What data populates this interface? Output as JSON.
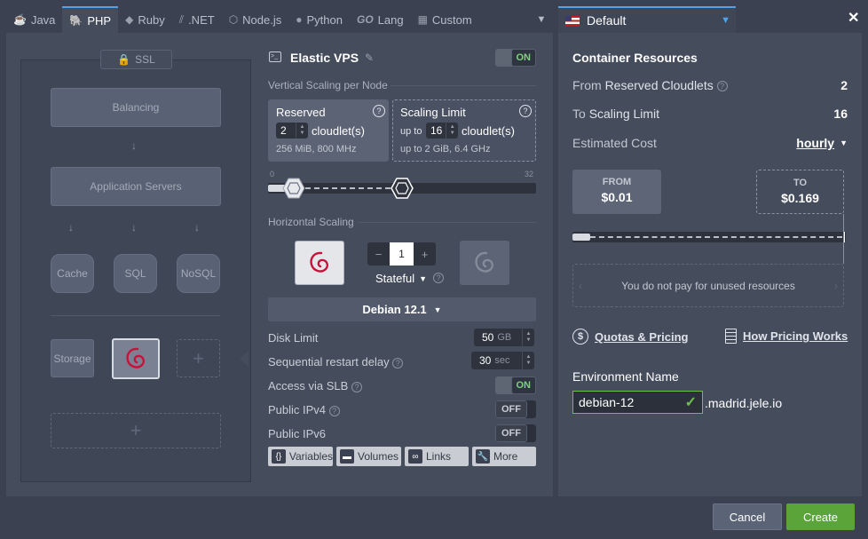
{
  "tabs": [
    {
      "label": "Java",
      "icon": "java-icon"
    },
    {
      "label": "PHP",
      "icon": "php-icon",
      "active": true
    },
    {
      "label": "Ruby",
      "icon": "ruby-icon"
    },
    {
      "label": ".NET",
      "icon": "dotnet-icon"
    },
    {
      "label": "Node.js",
      "icon": "nodejs-icon"
    },
    {
      "label": "Python",
      "icon": "python-icon"
    },
    {
      "label": "Lang",
      "icon": "go-icon",
      "logo": "GO"
    },
    {
      "label": "Custom",
      "icon": "custom-icon"
    }
  ],
  "region": {
    "label": "Default"
  },
  "close_symbol": "✕",
  "topology": {
    "ssl_label": "SSL",
    "balancing": "Balancing",
    "app_servers": "Application Servers",
    "cache": "Cache",
    "sql": "SQL",
    "nosql": "NoSQL",
    "storage": "Storage",
    "add_symbol": "+"
  },
  "node": {
    "title": "Elastic VPS",
    "power": "ON",
    "vertical_title": "Vertical Scaling per Node",
    "reserved": {
      "title": "Reserved",
      "value": "2",
      "unit": "cloudlet(s)",
      "spec": "256 MiB, 800 MHz"
    },
    "limit": {
      "title": "Scaling Limit",
      "prefix": "up to",
      "value": "16",
      "unit": "cloudlet(s)",
      "spec_prefix": "up to",
      "spec": "2 GiB, 6.4 GHz"
    },
    "slider_min": "0",
    "slider_max": "32",
    "slider": {
      "reserved": 2,
      "limit": 16,
      "max": 32
    },
    "horizontal_title": "Horizontal Scaling",
    "count": "1",
    "minus": "−",
    "plus": "+",
    "mode": "Stateful",
    "os": "Debian 12.1",
    "disk_label": "Disk Limit",
    "disk_value": "50",
    "disk_unit": "GB",
    "restart_label": "Sequential restart delay",
    "restart_value": "30",
    "restart_unit": "sec",
    "slb_label": "Access via SLB",
    "slb_state": "ON",
    "ipv4_label": "Public IPv4",
    "ipv4_state": "OFF",
    "ipv6_label": "Public IPv6",
    "ipv6_state": "OFF",
    "buttons": {
      "variables": "Variables",
      "volumes": "Volumes",
      "links": "Links",
      "more": "More"
    }
  },
  "resources": {
    "title": "Container Resources",
    "from_label_1": "From ",
    "from_label_2": "Reserved Cloudlets",
    "from_value": "2",
    "to_label_1": "To ",
    "to_label_2": "Scaling Limit",
    "to_value": "16",
    "cost_label": "Estimated Cost",
    "cost_period": "hourly",
    "from_price_label": "FROM",
    "from_price": "$0.01",
    "to_price_label": "TO",
    "to_price": "$0.169",
    "note": "You do not pay for unused resources",
    "quotas_link": "Quotas & Pricing",
    "how_link": "How Pricing Works",
    "env_label": "Environment Name",
    "env_value": "debian-12",
    "env_domain": ".madrid.jele.io"
  },
  "footer": {
    "cancel": "Cancel",
    "create": "Create"
  },
  "colors": {
    "accent": "#4fa3e6",
    "create": "#5aa43a",
    "cancel": "#5b6476",
    "on_green": "#7dd27c",
    "valid": "#6cc04a"
  }
}
